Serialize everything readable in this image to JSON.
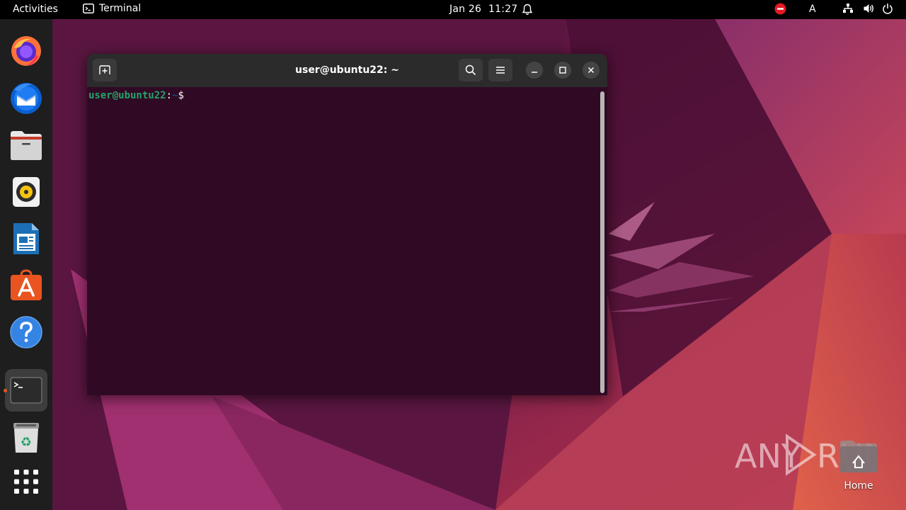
{
  "topbar": {
    "activities": "Activities",
    "app_name": "Terminal",
    "date": "Jan 26",
    "time": "11:27",
    "input_indicator": "A"
  },
  "dock": {
    "items": [
      {
        "name": "firefox-icon"
      },
      {
        "name": "thunderbird-icon"
      },
      {
        "name": "files-icon"
      },
      {
        "name": "rhythmbox-icon"
      },
      {
        "name": "libreoffice-writer-icon"
      },
      {
        "name": "app-center-icon"
      },
      {
        "name": "help-icon"
      },
      {
        "name": "terminal-icon",
        "active": true
      },
      {
        "name": "trash-icon"
      },
      {
        "name": "show-apps-icon"
      }
    ]
  },
  "terminal": {
    "title": "user@ubuntu22: ~",
    "prompt_user": "user@ubuntu22",
    "prompt_colon": ":",
    "prompt_path": "~",
    "prompt_sigil": "$"
  },
  "desktop": {
    "home_label": "Home"
  },
  "watermark": {
    "text_left": "ANY",
    "text_right": "RUN"
  },
  "colors": {
    "accent": "#e95420",
    "terminal_bg": "#300a24",
    "prompt_user": "#26a269",
    "prompt_path": "#12488b"
  }
}
